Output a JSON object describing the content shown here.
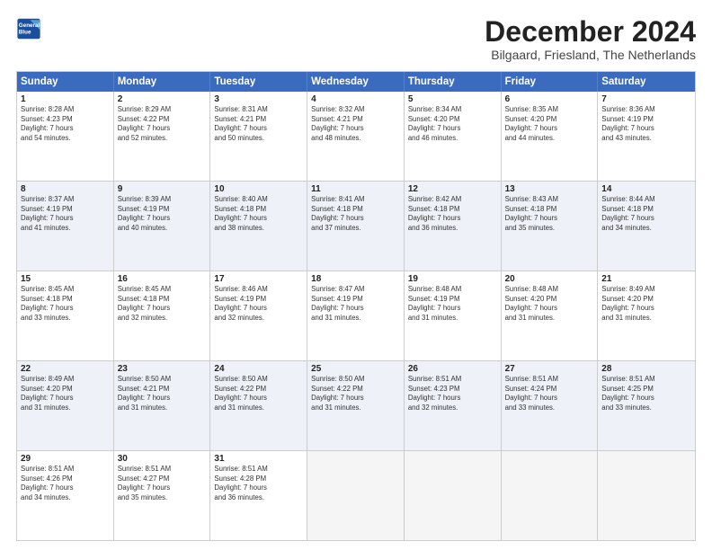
{
  "header": {
    "logo_line1": "General",
    "logo_line2": "Blue",
    "month": "December 2024",
    "location": "Bilgaard, Friesland, The Netherlands"
  },
  "days": [
    "Sunday",
    "Monday",
    "Tuesday",
    "Wednesday",
    "Thursday",
    "Friday",
    "Saturday"
  ],
  "weeks": [
    [
      {
        "day": "1",
        "lines": [
          "Sunrise: 8:28 AM",
          "Sunset: 4:23 PM",
          "Daylight: 7 hours",
          "and 54 minutes."
        ]
      },
      {
        "day": "2",
        "lines": [
          "Sunrise: 8:29 AM",
          "Sunset: 4:22 PM",
          "Daylight: 7 hours",
          "and 52 minutes."
        ]
      },
      {
        "day": "3",
        "lines": [
          "Sunrise: 8:31 AM",
          "Sunset: 4:21 PM",
          "Daylight: 7 hours",
          "and 50 minutes."
        ]
      },
      {
        "day": "4",
        "lines": [
          "Sunrise: 8:32 AM",
          "Sunset: 4:21 PM",
          "Daylight: 7 hours",
          "and 48 minutes."
        ]
      },
      {
        "day": "5",
        "lines": [
          "Sunrise: 8:34 AM",
          "Sunset: 4:20 PM",
          "Daylight: 7 hours",
          "and 46 minutes."
        ]
      },
      {
        "day": "6",
        "lines": [
          "Sunrise: 8:35 AM",
          "Sunset: 4:20 PM",
          "Daylight: 7 hours",
          "and 44 minutes."
        ]
      },
      {
        "day": "7",
        "lines": [
          "Sunrise: 8:36 AM",
          "Sunset: 4:19 PM",
          "Daylight: 7 hours",
          "and 43 minutes."
        ]
      }
    ],
    [
      {
        "day": "8",
        "lines": [
          "Sunrise: 8:37 AM",
          "Sunset: 4:19 PM",
          "Daylight: 7 hours",
          "and 41 minutes."
        ]
      },
      {
        "day": "9",
        "lines": [
          "Sunrise: 8:39 AM",
          "Sunset: 4:19 PM",
          "Daylight: 7 hours",
          "and 40 minutes."
        ]
      },
      {
        "day": "10",
        "lines": [
          "Sunrise: 8:40 AM",
          "Sunset: 4:18 PM",
          "Daylight: 7 hours",
          "and 38 minutes."
        ]
      },
      {
        "day": "11",
        "lines": [
          "Sunrise: 8:41 AM",
          "Sunset: 4:18 PM",
          "Daylight: 7 hours",
          "and 37 minutes."
        ]
      },
      {
        "day": "12",
        "lines": [
          "Sunrise: 8:42 AM",
          "Sunset: 4:18 PM",
          "Daylight: 7 hours",
          "and 36 minutes."
        ]
      },
      {
        "day": "13",
        "lines": [
          "Sunrise: 8:43 AM",
          "Sunset: 4:18 PM",
          "Daylight: 7 hours",
          "and 35 minutes."
        ]
      },
      {
        "day": "14",
        "lines": [
          "Sunrise: 8:44 AM",
          "Sunset: 4:18 PM",
          "Daylight: 7 hours",
          "and 34 minutes."
        ]
      }
    ],
    [
      {
        "day": "15",
        "lines": [
          "Sunrise: 8:45 AM",
          "Sunset: 4:18 PM",
          "Daylight: 7 hours",
          "and 33 minutes."
        ]
      },
      {
        "day": "16",
        "lines": [
          "Sunrise: 8:45 AM",
          "Sunset: 4:18 PM",
          "Daylight: 7 hours",
          "and 32 minutes."
        ]
      },
      {
        "day": "17",
        "lines": [
          "Sunrise: 8:46 AM",
          "Sunset: 4:19 PM",
          "Daylight: 7 hours",
          "and 32 minutes."
        ]
      },
      {
        "day": "18",
        "lines": [
          "Sunrise: 8:47 AM",
          "Sunset: 4:19 PM",
          "Daylight: 7 hours",
          "and 31 minutes."
        ]
      },
      {
        "day": "19",
        "lines": [
          "Sunrise: 8:48 AM",
          "Sunset: 4:19 PM",
          "Daylight: 7 hours",
          "and 31 minutes."
        ]
      },
      {
        "day": "20",
        "lines": [
          "Sunrise: 8:48 AM",
          "Sunset: 4:20 PM",
          "Daylight: 7 hours",
          "and 31 minutes."
        ]
      },
      {
        "day": "21",
        "lines": [
          "Sunrise: 8:49 AM",
          "Sunset: 4:20 PM",
          "Daylight: 7 hours",
          "and 31 minutes."
        ]
      }
    ],
    [
      {
        "day": "22",
        "lines": [
          "Sunrise: 8:49 AM",
          "Sunset: 4:20 PM",
          "Daylight: 7 hours",
          "and 31 minutes."
        ]
      },
      {
        "day": "23",
        "lines": [
          "Sunrise: 8:50 AM",
          "Sunset: 4:21 PM",
          "Daylight: 7 hours",
          "and 31 minutes."
        ]
      },
      {
        "day": "24",
        "lines": [
          "Sunrise: 8:50 AM",
          "Sunset: 4:22 PM",
          "Daylight: 7 hours",
          "and 31 minutes."
        ]
      },
      {
        "day": "25",
        "lines": [
          "Sunrise: 8:50 AM",
          "Sunset: 4:22 PM",
          "Daylight: 7 hours",
          "and 31 minutes."
        ]
      },
      {
        "day": "26",
        "lines": [
          "Sunrise: 8:51 AM",
          "Sunset: 4:23 PM",
          "Daylight: 7 hours",
          "and 32 minutes."
        ]
      },
      {
        "day": "27",
        "lines": [
          "Sunrise: 8:51 AM",
          "Sunset: 4:24 PM",
          "Daylight: 7 hours",
          "and 33 minutes."
        ]
      },
      {
        "day": "28",
        "lines": [
          "Sunrise: 8:51 AM",
          "Sunset: 4:25 PM",
          "Daylight: 7 hours",
          "and 33 minutes."
        ]
      }
    ],
    [
      {
        "day": "29",
        "lines": [
          "Sunrise: 8:51 AM",
          "Sunset: 4:26 PM",
          "Daylight: 7 hours",
          "and 34 minutes."
        ]
      },
      {
        "day": "30",
        "lines": [
          "Sunrise: 8:51 AM",
          "Sunset: 4:27 PM",
          "Daylight: 7 hours",
          "and 35 minutes."
        ]
      },
      {
        "day": "31",
        "lines": [
          "Sunrise: 8:51 AM",
          "Sunset: 4:28 PM",
          "Daylight: 7 hours",
          "and 36 minutes."
        ]
      },
      null,
      null,
      null,
      null
    ]
  ]
}
